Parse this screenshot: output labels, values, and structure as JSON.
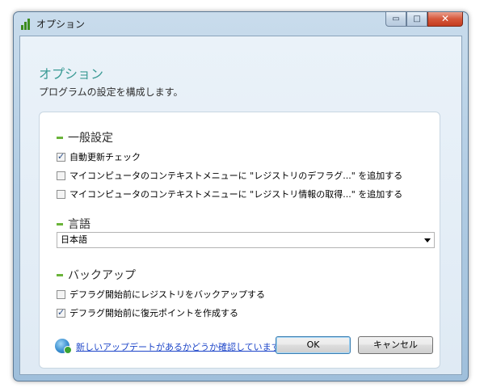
{
  "window": {
    "title": "オプション",
    "caption_buttons": {
      "minimize": "▭",
      "maximize": "□",
      "close": "✕"
    }
  },
  "header": {
    "title": "オプション",
    "subtitle": "プログラムの設定を構成します。"
  },
  "sections": {
    "general": {
      "title": "一般設定",
      "options": [
        {
          "label": "自動更新チェック",
          "checked": true
        },
        {
          "label": "マイコンピュータのコンテキストメニューに \"レジストリのデフラグ...\" を追加する",
          "checked": false
        },
        {
          "label": "マイコンピュータのコンテキストメニューに \"レジストリ情報の取得...\" を追加する",
          "checked": false
        }
      ]
    },
    "language": {
      "title": "言語",
      "selected": "日本語"
    },
    "backup": {
      "title": "バックアップ",
      "options": [
        {
          "label": "デフラグ開始前にレジストリをバックアップする",
          "checked": false
        },
        {
          "label": "デフラグ開始前に復元ポイントを作成する",
          "checked": true
        }
      ]
    }
  },
  "footer": {
    "update_link": "新しいアップデートがあるかどうか確認しています...",
    "ok_label": "OK",
    "cancel_label": "キャンセル"
  },
  "colors": {
    "accent_title": "#3a9a94",
    "section_bullet": "#6ab43a",
    "link": "#1f47c9"
  },
  "icons": {
    "app": "bar-chart-icon",
    "update": "globe-update-icon"
  }
}
